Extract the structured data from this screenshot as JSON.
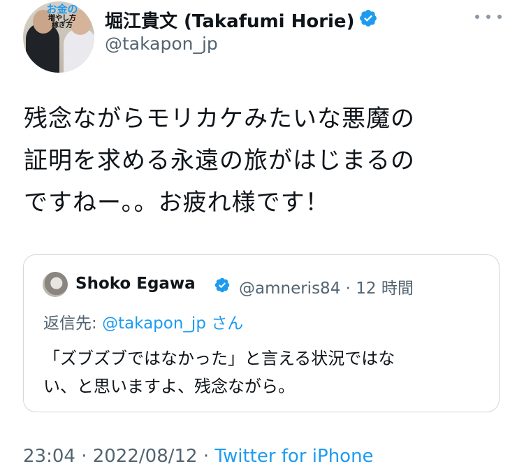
{
  "author": {
    "display_name": "堀江貴文 (Takafumi Horie)",
    "handle": "@takapon_jp",
    "avatar_book_title_line1": "お金の",
    "avatar_book_title_line2": "増やし方",
    "avatar_book_title_line3": "稼ぎ方"
  },
  "tweet": {
    "text": "残念ながらモリカケみたいな悪魔の\n証明を求める永遠の旅がはじまるの\nですねー。。お疲れ様です！"
  },
  "quote": {
    "name": "Shoko Egawa",
    "handle_and_time": "@amneris84 · 12 時間",
    "reply_prefix": "返信先: ",
    "reply_mention": "@takapon_jp",
    "reply_suffix": " さん",
    "text": "「ズブズブではなかった」と言える状況ではな\nい、と思いますよ、残念ながら。"
  },
  "meta": {
    "time_date": "23:04 · 2022/08/12 · ",
    "source": "Twitter for iPhone"
  },
  "colors": {
    "accent": "#1d9bf0",
    "secondary_text": "#536471",
    "border": "#cfd9de"
  },
  "icons": [
    "verified-icon",
    "more-icon"
  ]
}
